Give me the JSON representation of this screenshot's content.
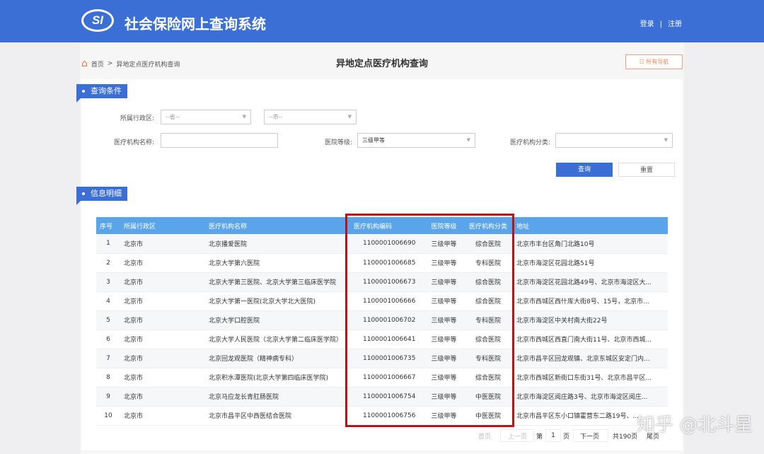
{
  "header": {
    "logo": "SI",
    "title": "社会保险网上查询系统",
    "login": "登录",
    "sep": "|",
    "register": "注册"
  },
  "breadcrumb": {
    "home": "首页",
    "sep": ">",
    "current": "异地定点医疗机构查询"
  },
  "page_title": "异地定点医疗机构查询",
  "nav_button": "☷ 所有导航",
  "query": {
    "section": "查询条件",
    "region_label": "所属行政区:",
    "province_placeholder": "--省--",
    "city_placeholder": "--市--",
    "name_label": "医疗机构名称:",
    "name_value": "",
    "level_label": "医院等级:",
    "level_value": "三级甲等",
    "category_label": "医疗机构分类:",
    "category_value": "",
    "search": "查询",
    "reset": "重置"
  },
  "details": {
    "section": "信息明细"
  },
  "table": {
    "headers": [
      "序号",
      "所属行政区",
      "医疗机构名称",
      "医疗机构编码",
      "医院等级",
      "医疗机构分类",
      "地址"
    ],
    "rows": [
      [
        "1",
        "北京市",
        "北京播爱医院",
        "1100001006690",
        "三级甲等",
        "综合医院",
        "北京市丰台区角门北路10号"
      ],
      [
        "2",
        "北京市",
        "北京大学第六医院",
        "1100001006685",
        "三级甲等",
        "专科医院",
        "北京市海淀区花园北路51号"
      ],
      [
        "3",
        "北京市",
        "北京大学第三医院、北京大学第三临床医学院",
        "1100001006673",
        "三级甲等",
        "综合医院",
        "北京市海淀区花园北路49号、北京市海淀区大..."
      ],
      [
        "4",
        "北京市",
        "北京大学第一医院(北京大学北大医院)",
        "1100001006666",
        "三级甲等",
        "综合医院",
        "北京市西城区西什库大街8号、15号，北京市..."
      ],
      [
        "5",
        "北京市",
        "北京大学口腔医院",
        "1100001006702",
        "三级甲等",
        "专科医院",
        "北京市海淀区中关村南大街22号"
      ],
      [
        "6",
        "北京市",
        "北京大学人民医院（北京大学第二临床医学院）",
        "1100001006641",
        "三级甲等",
        "综合医院",
        "北京市西城区西直门南大街11号、北京市西城..."
      ],
      [
        "7",
        "北京市",
        "北京回龙观医院（精神病专科）",
        "1100001006735",
        "三级甲等",
        "专科医院",
        "北京市昌平区回龙观镇、北京东城区安定门内..."
      ],
      [
        "8",
        "北京市",
        "北京积水潭医院(北京大学第四临床医学院)",
        "1100001006667",
        "三级甲等",
        "综合医院",
        "北京市西城区新街口东街31号、北京市昌平区..."
      ],
      [
        "9",
        "北京市",
        "北京马应龙长青肛肠医院",
        "1100001006754",
        "三级甲等",
        "中医医院",
        "北京市海淀区阅庄路3号、北京市海淀区阅庄..."
      ],
      [
        "10",
        "北京市",
        "北京市昌平区中西医结合医院",
        "1100001006756",
        "三级甲等",
        "中医医院",
        "北京市昌平区东小口镇霍营东二路19号、..."
      ]
    ]
  },
  "pagination": {
    "first": "首页",
    "prev": "上一页",
    "page_prefix": "第",
    "page": "1",
    "page_suffix": "页",
    "next": "下一页",
    "total": "共190页",
    "last": "尾页"
  },
  "watermark": "知乎 @北斗星",
  "colors": {
    "brand": "#3b6fd6",
    "table_header": "#5aa4ea",
    "highlight": "#b5161e"
  }
}
